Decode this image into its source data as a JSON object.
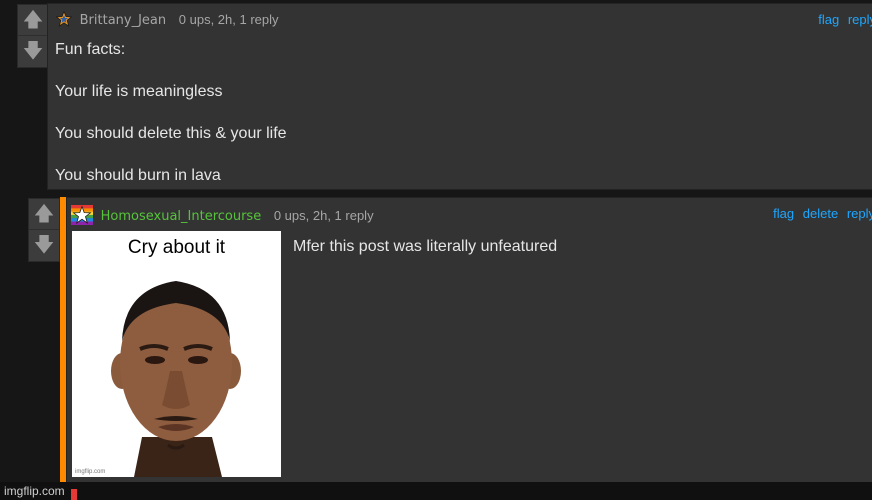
{
  "comments": [
    {
      "username": "Brittany_Jean",
      "meta": "0 ups, 2h, 1 reply",
      "actions": [
        "flag",
        "reply"
      ],
      "lines": [
        "Fun facts:",
        "Your life is meaningless",
        "You should delete this & your life",
        "You should burn in lava"
      ],
      "badge_icon": "star-badge-icon"
    },
    {
      "username": "Homosexual_Intercourse",
      "meta": "0 ups, 2h, 1 reply",
      "actions": [
        "flag",
        "delete",
        "reply"
      ],
      "text": "Mfer this post was literally unfeatured",
      "badge_icon": "rainbow-star-badge-icon",
      "meme": {
        "caption": "Cry about it",
        "small_watermark": "imgflip.com"
      }
    }
  ],
  "footer": {
    "watermark": "imgflip.com"
  },
  "colors": {
    "link": "#1ea7ff",
    "reply_accent": "#ff8a00",
    "username_green": "#55c43a",
    "username_gray": "#a6a6a6"
  }
}
